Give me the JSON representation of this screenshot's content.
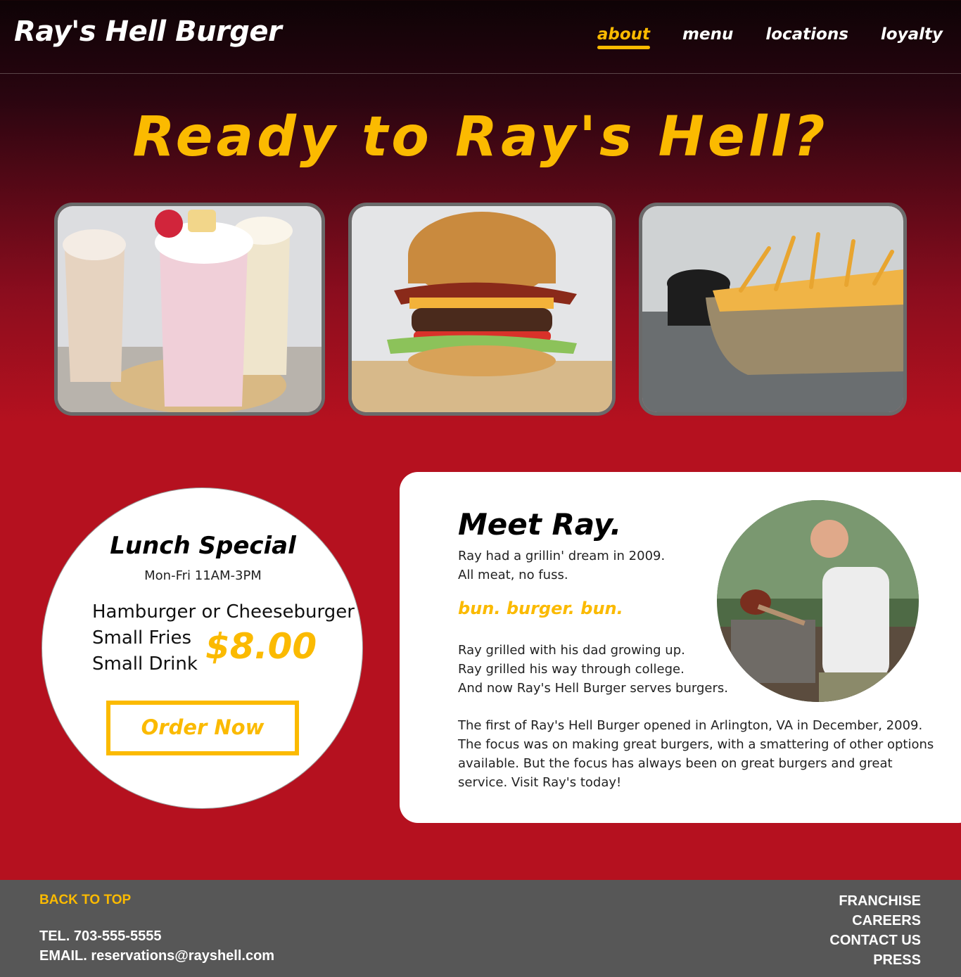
{
  "header": {
    "logo": "Ray's Hell Burger",
    "nav": [
      {
        "label": "about",
        "active": true
      },
      {
        "label": "menu",
        "active": false
      },
      {
        "label": "locations",
        "active": false
      },
      {
        "label": "loyalty",
        "active": false
      }
    ]
  },
  "hero": {
    "title": "Ready to Ray's Hell?"
  },
  "gallery": [
    {
      "icon": "milkshakes-image"
    },
    {
      "icon": "burger-image"
    },
    {
      "icon": "fries-image"
    }
  ],
  "special": {
    "title": "Lunch Special",
    "hours": "Mon-Fri 11AM-3PM",
    "items": [
      "Hamburger or Cheeseburger",
      "Small Fries",
      "Small Drink"
    ],
    "price": "$8.00",
    "order_label": "Order Now"
  },
  "meet": {
    "title": "Meet Ray.",
    "intro": [
      "Ray had a grillin' dream in 2009.",
      "All meat, no fuss."
    ],
    "slogan": "bun. burger. bun.",
    "story": [
      "Ray grilled with his dad growing up.",
      "Ray grilled his way through college.",
      "And now Ray's Hell Burger serves burgers."
    ],
    "history": "The first of Ray's Hell Burger opened in Arlington, VA in December, 2009.  The focus was on making great burgers, with a smattering of other options available.  But the focus has always been on great burgers and great service.  Visit Ray's today!"
  },
  "footer": {
    "back_to_top": "BACK TO TOP",
    "tel": "TEL. 703-555-5555",
    "email": "EMAIL. reservations@rayshell.com",
    "links": [
      "FRANCHISE",
      "CAREERS",
      "CONTACT US",
      "PRESS"
    ]
  },
  "colors": {
    "accent": "#fbba00",
    "brand_red": "#b5111f",
    "footer_bg": "#575757"
  }
}
